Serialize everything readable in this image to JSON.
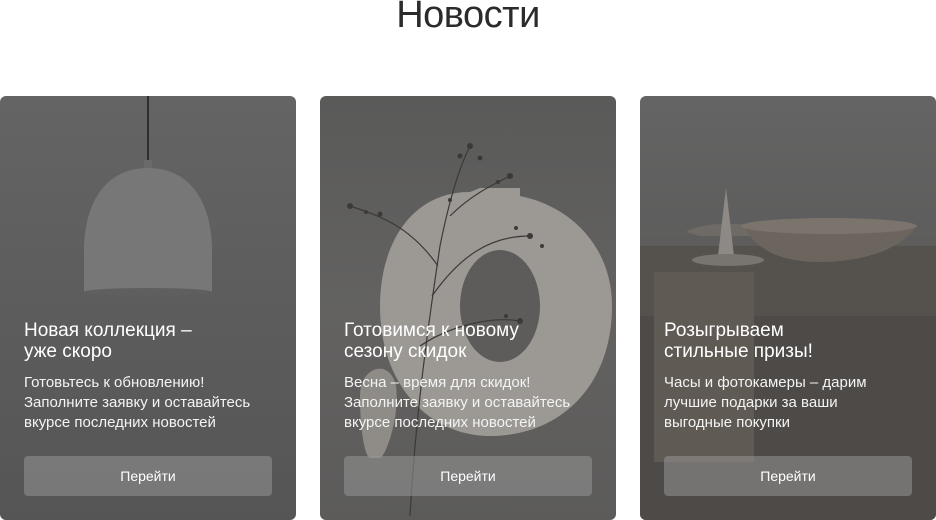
{
  "page": {
    "title": "Новости"
  },
  "cards": [
    {
      "title": "Новая коллекция –\nуже скоро",
      "text": "Готовьтесь к обновлению!\nЗаполните заявку и оставайтесь\nвкурсе последних новостей",
      "button_label": "Перейти",
      "image": "pendant-lamp-photo"
    },
    {
      "title": "Готовимся к новому\nсезону скидок",
      "text": "Весна – время для скидок!\nЗаполните заявку и оставайтесь\nвкурсе последних новостей",
      "button_label": "Перейти",
      "image": "ceramic-vase-photo"
    },
    {
      "title": "Розыгрываем\nстильные призы!",
      "text": "Часы и фотокамеры – дарим\nлучшие подарки за ваши\nвыгодные покупки",
      "button_label": "Перейти",
      "image": "wooden-bowl-photo"
    }
  ]
}
